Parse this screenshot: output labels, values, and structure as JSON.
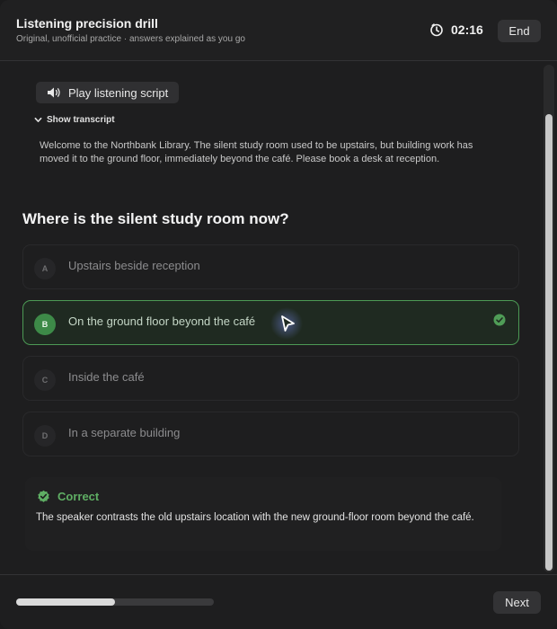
{
  "header": {
    "title": "Listening precision drill",
    "subtitle": "Original, unofficial practice · answers explained as you go",
    "timer": "02:16",
    "end_label": "End"
  },
  "player": {
    "play_label": "Play listening script",
    "play_icon": "speaker-icon"
  },
  "transcript": {
    "toggle_label": "Show transcript",
    "text": "Welcome to the Northbank Library. The silent study room used to be upstairs, but building work has moved it to the ground floor, immediately beyond the café. Please book a desk at reception."
  },
  "question": {
    "text": "Where is the silent study room now?"
  },
  "options": [
    {
      "letter": "A",
      "label": "Upstairs beside reception",
      "selected": false
    },
    {
      "letter": "B",
      "label": "On the ground floor beyond the café",
      "selected": true
    },
    {
      "letter": "C",
      "label": "Inside the café",
      "selected": false
    },
    {
      "letter": "D",
      "label": "In a separate building",
      "selected": false
    }
  ],
  "feedback": {
    "title": "Correct",
    "text": "The speaker contrasts the old upstairs location with the new ground-floor room beyond the café."
  },
  "footer": {
    "progress": 0.5,
    "next_label": "Next"
  },
  "colors": {
    "accent_green": "#4c9a55",
    "correct_text": "#5fae64",
    "background": "#1e1e1f"
  }
}
